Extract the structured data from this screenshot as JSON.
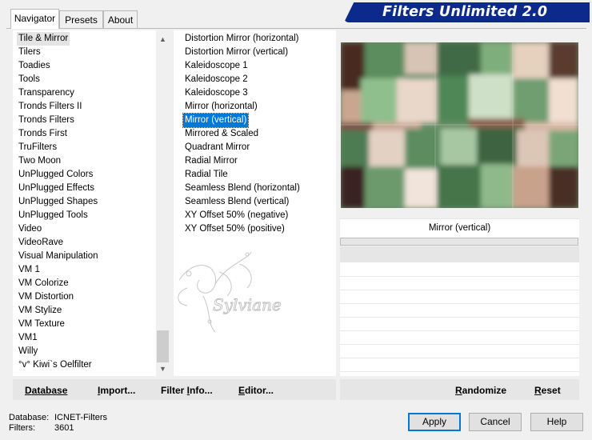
{
  "title": "Filters Unlimited 2.0",
  "tabs": [
    {
      "label": "Navigator",
      "active": true
    },
    {
      "label": "Presets",
      "active": false
    },
    {
      "label": "About",
      "active": false
    }
  ],
  "categories": [
    {
      "label": "Tile & Mirror",
      "selected": true
    },
    {
      "label": "Tilers"
    },
    {
      "label": "Toadies"
    },
    {
      "label": "Tools"
    },
    {
      "label": "Transparency"
    },
    {
      "label": "Tronds Filters II"
    },
    {
      "label": "Tronds Filters"
    },
    {
      "label": "Tronds First"
    },
    {
      "label": "TruFilters"
    },
    {
      "label": "Two Moon"
    },
    {
      "label": "UnPlugged Colors"
    },
    {
      "label": "UnPlugged Effects"
    },
    {
      "label": "UnPlugged Shapes"
    },
    {
      "label": "UnPlugged Tools"
    },
    {
      "label": "Video"
    },
    {
      "label": "VideoRave"
    },
    {
      "label": "Visual Manipulation"
    },
    {
      "label": "VM 1"
    },
    {
      "label": "VM Colorize"
    },
    {
      "label": "VM Distortion"
    },
    {
      "label": "VM Stylize"
    },
    {
      "label": "VM Texture"
    },
    {
      "label": "VM1"
    },
    {
      "label": "Willy"
    },
    {
      "label": "°v° Kiwi`s Oelfilter"
    }
  ],
  "filters": [
    {
      "label": "Distortion Mirror (horizontal)"
    },
    {
      "label": "Distortion Mirror (vertical)"
    },
    {
      "label": "Kaleidoscope 1"
    },
    {
      "label": "Kaleidoscope 2"
    },
    {
      "label": "Kaleidoscope 3"
    },
    {
      "label": "Mirror (horizontal)"
    },
    {
      "label": "Mirror (vertical)",
      "selected": true
    },
    {
      "label": "Mirrored & Scaled"
    },
    {
      "label": "Quadrant Mirror"
    },
    {
      "label": "Radial Mirror"
    },
    {
      "label": "Radial Tile"
    },
    {
      "label": "Seamless Blend (horizontal)"
    },
    {
      "label": "Seamless Blend (vertical)"
    },
    {
      "label": "XY Offset 50% (negative)"
    },
    {
      "label": "XY Offset 50% (positive)"
    }
  ],
  "watermark_text": "Sylviane",
  "preview": {
    "selected_filter": "Mirror (vertical)"
  },
  "left_bar": {
    "database": {
      "u": "D",
      "rest": "atabase"
    },
    "import": {
      "u": "I",
      "rest": "mport..."
    },
    "filter_info": {
      "pre": "Filter ",
      "u": "I",
      "rest": "nfo..."
    },
    "editor": {
      "u": "E",
      "rest": "ditor..."
    }
  },
  "right_bar": {
    "randomize": {
      "u": "R",
      "rest": "andomize"
    },
    "reset": {
      "u": "R",
      "rest": "eset"
    }
  },
  "status": {
    "database_label": "Database:",
    "database_value": "ICNET-Filters",
    "filters_label": "Filters:",
    "filters_value": "3601"
  },
  "buttons": {
    "apply": "Apply",
    "cancel": "Cancel",
    "help": "Help"
  },
  "colors": {
    "banner": "#0c2a8c",
    "selection": "#0078d7"
  }
}
